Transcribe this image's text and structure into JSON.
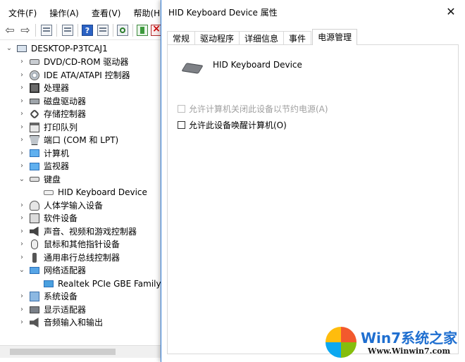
{
  "device_manager": {
    "menus": [
      "文件(F)",
      "操作(A)",
      "查看(V)",
      "帮助(H)"
    ],
    "tree": {
      "root": "DESKTOP-P3TCAJ1",
      "items": [
        {
          "label": "DVD/CD-ROM 驱动器",
          "icon": "dvd-drive-icon",
          "expanded": false
        },
        {
          "label": "IDE ATA/ATAPI 控制器",
          "icon": "ide-controller-icon",
          "expanded": false
        },
        {
          "label": "处理器",
          "icon": "processor-icon",
          "expanded": false
        },
        {
          "label": "磁盘驱动器",
          "icon": "disk-drive-icon",
          "expanded": false
        },
        {
          "label": "存储控制器",
          "icon": "storage-controller-icon",
          "expanded": false
        },
        {
          "label": "打印队列",
          "icon": "printer-icon",
          "expanded": false
        },
        {
          "label": "端口 (COM 和 LPT)",
          "icon": "port-icon",
          "expanded": false
        },
        {
          "label": "计算机",
          "icon": "computer-icon",
          "expanded": false
        },
        {
          "label": "监视器",
          "icon": "monitor-icon",
          "expanded": false
        },
        {
          "label": "键盘",
          "icon": "keyboard-icon",
          "expanded": true
        },
        {
          "label": "HID Keyboard Device",
          "icon": "hid-keyboard-icon",
          "child": true
        },
        {
          "label": "人体学输入设备",
          "icon": "hid-device-icon",
          "expanded": false
        },
        {
          "label": "软件设备",
          "icon": "software-device-icon",
          "expanded": false
        },
        {
          "label": "声音、视频和游戏控制器",
          "icon": "sound-controller-icon",
          "expanded": false
        },
        {
          "label": "鼠标和其他指针设备",
          "icon": "mouse-icon",
          "expanded": false
        },
        {
          "label": "通用串行总线控制器",
          "icon": "usb-controller-icon",
          "expanded": false
        },
        {
          "label": "网络适配器",
          "icon": "network-adapter-icon",
          "expanded": true
        },
        {
          "label": "Realtek PCIe GBE Family Co",
          "icon": "nic-icon",
          "child": true
        },
        {
          "label": "系统设备",
          "icon": "system-device-icon",
          "expanded": false
        },
        {
          "label": "显示适配器",
          "icon": "display-adapter-icon",
          "expanded": false
        },
        {
          "label": "音频输入和输出",
          "icon": "audio-io-icon",
          "expanded": false
        }
      ]
    }
  },
  "dialog": {
    "title": "HID Keyboard Device 属性",
    "close_glyph": "✕",
    "tabs": [
      "常规",
      "驱动程序",
      "详细信息",
      "事件",
      "电源管理"
    ],
    "active_tab": "电源管理",
    "device_name": "HID Keyboard Device",
    "options": [
      {
        "label": "允许计算机关闭此设备以节约电源(A)",
        "checked": false,
        "disabled": true
      },
      {
        "label": "允许此设备唤醒计算机(O)",
        "checked": false,
        "disabled": false
      }
    ]
  },
  "watermark": {
    "text": "Win7系统之家",
    "url": "Www.Winwin7.com"
  },
  "colors": {
    "dialog_border": "#2d7ad6",
    "watermark_text": "#1f6fd0"
  }
}
